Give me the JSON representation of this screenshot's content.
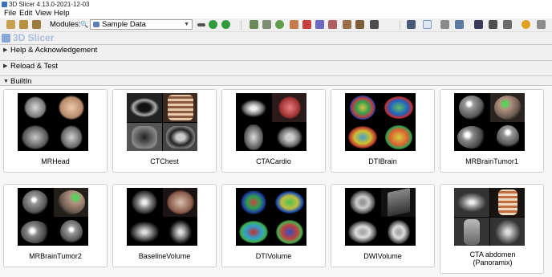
{
  "window": {
    "title": "3D Slicer 4.13.0-2021-12-03"
  },
  "menu": [
    "File",
    "Edit",
    "View",
    "Help"
  ],
  "toolbar": {
    "modules_label": "Modules:",
    "selected_module": "Sample Data",
    "left_icons": [
      "load-data-icon",
      "dicom-icon",
      "save-icon"
    ],
    "right_icons": [
      "history-back-icon",
      "history-forward-icon",
      "data-module-icon",
      "volumes-module-icon",
      "models-module-icon",
      "transforms-module-icon",
      "markups-module-icon",
      "segment-editor-icon",
      "extensions-icon",
      "python-icon",
      "layout-icon",
      "mouse-mode-icon",
      "crosshair-icon",
      "screenshot-icon",
      "capture-icon",
      "settings-icon"
    ]
  },
  "app_logo_text": "3D Slicer",
  "sections": {
    "help": "Help & Acknowledgement",
    "reload": "Reload & Test",
    "builtin": "BuiltIn"
  },
  "datasets": [
    {
      "name": "MRHead"
    },
    {
      "name": "CTChest"
    },
    {
      "name": "CTACardio"
    },
    {
      "name": "DTIBrain"
    },
    {
      "name": "MRBrainTumor1"
    },
    {
      "name": "MRBrainTumor2"
    },
    {
      "name": "BaselineVolume"
    },
    {
      "name": "DTIVolume"
    },
    {
      "name": "DWIVolume"
    },
    {
      "name": "CTA abdomen (Panoramix)"
    }
  ],
  "colors": {
    "logo_text": "#a8bde0",
    "accent": "#3a6fc4"
  }
}
